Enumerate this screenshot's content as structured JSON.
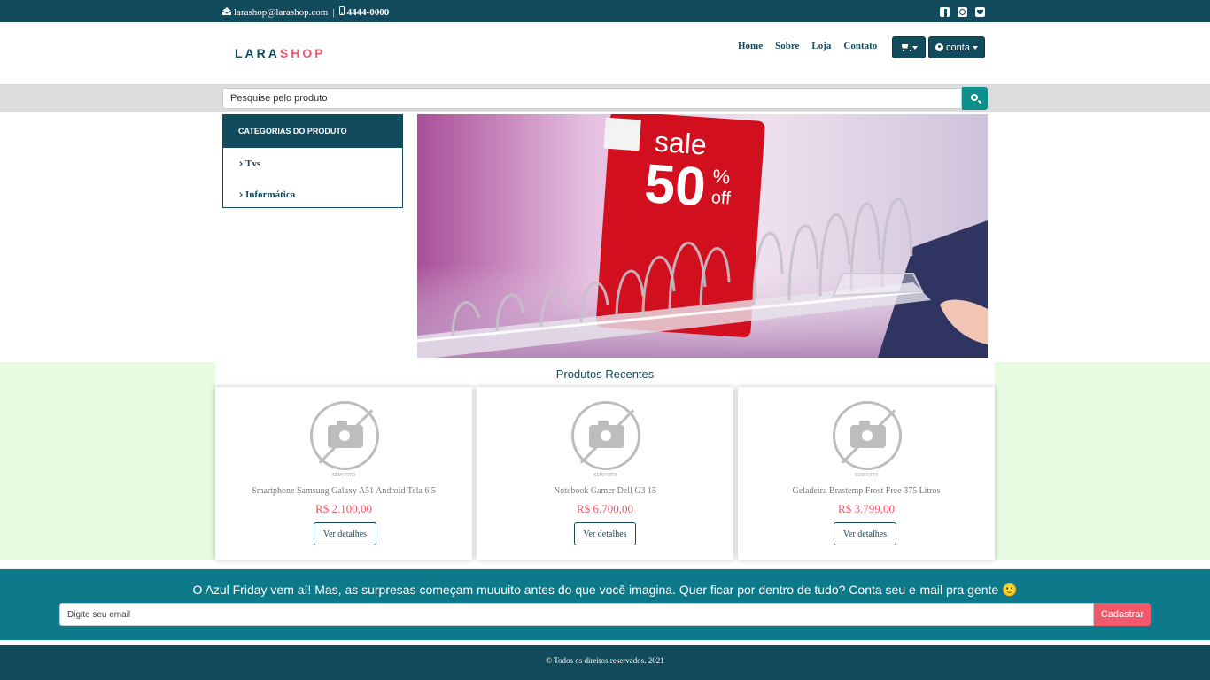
{
  "topbar": {
    "email": "larashop@larashop.com",
    "separator": "|",
    "phone": "4444-0000",
    "social_icons": [
      "facebook-icon",
      "instagram-icon",
      "twitter-icon"
    ]
  },
  "header": {
    "logo_part1": "LARA",
    "logo_part2": "SHOP",
    "nav": [
      "Home",
      "Sobre",
      "Loja",
      "Contato"
    ],
    "account_label": "conta"
  },
  "search": {
    "placeholder": "Pesquise pelo produto"
  },
  "categories": {
    "title": "CATEGORIAS DO PRODUTO",
    "items": [
      "Tvs",
      "Informática"
    ]
  },
  "banner": {
    "sale_word": "sale",
    "sale_value": "50",
    "sale_percent": "%",
    "sale_off": "off"
  },
  "recent": {
    "title": "Produtos Recentes",
    "no_photo_text": "SEM FOTO",
    "products": [
      {
        "name": "Smartphone Samsung Galaxy A51 Android Tela 6,5",
        "price": "R$ 2.100,00",
        "button": "Ver detalhes"
      },
      {
        "name": "Notebook Gamer Dell G3 15",
        "price": "R$ 6.700,00",
        "button": "Ver detalhes"
      },
      {
        "name": "Geladeira Brastemp Frost Free 375 Litros",
        "price": "R$ 3.799,00",
        "button": "Ver detalhes"
      }
    ]
  },
  "newsletter": {
    "text": "O Azul Friday vem aí! Mas, as surpresas começam muuuito antes do que você imagina. Quer ficar por dentro de tudo? Conta seu e-mail pra gente 🙂",
    "placeholder": "Digite seu email",
    "button": "Cadastrar"
  },
  "footer": {
    "text": "© Todos os direitos reservados. 2021"
  },
  "colors": {
    "primary": "#124a5e",
    "accent": "#f0596a",
    "teal": "#0d8f8c",
    "newsletter_bg": "#0d7a8c",
    "products_band": "#e6fbe0"
  }
}
